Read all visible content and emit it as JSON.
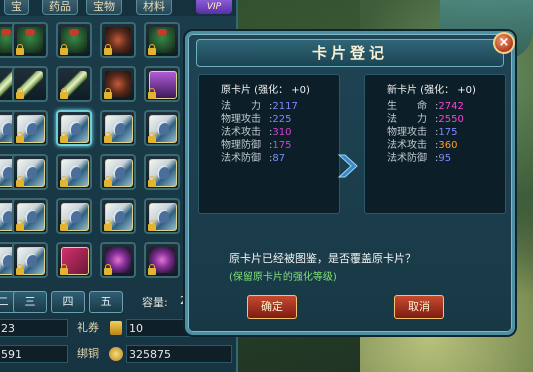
{
  "inventory": {
    "tabs": [
      {
        "label": "宝"
      },
      {
        "label": "药品"
      },
      {
        "label": "宝物"
      },
      {
        "label": "材料"
      }
    ],
    "vip_label": "VIP",
    "pages": [
      "二",
      "三",
      "四",
      "五"
    ],
    "capacity_label": "容量:",
    "capacity_value": "2",
    "gift_label": "礼券",
    "gift_value": "10",
    "bound_label": "绑铜",
    "bound_value": "325875",
    "left_value_1": "23",
    "left_value_2": "591"
  },
  "dialog": {
    "title": "卡片登记",
    "close_label": "×",
    "old_card": {
      "header": "原卡片 (强化： +0)",
      "stats": [
        {
          "name": "法　　力",
          "value": "2117",
          "color": "#7f88ff"
        },
        {
          "name": "物理攻击",
          "value": "225",
          "color": "#7f88ff"
        },
        {
          "name": "法术攻击",
          "value": "310",
          "color": "#d640d6"
        },
        {
          "name": "物理防御",
          "value": "175",
          "color": "#d640d6"
        },
        {
          "name": "法术防御",
          "value": "87",
          "color": "#7f88ff"
        }
      ]
    },
    "new_card": {
      "header": "新卡片 (强化： +0)",
      "stats": [
        {
          "name": "生　　命",
          "value": "2742",
          "color": "#ff40d8"
        },
        {
          "name": "法　　力",
          "value": "2550",
          "color": "#ff40d8"
        },
        {
          "name": "物理攻击",
          "value": "175",
          "color": "#7f88ff"
        },
        {
          "name": "法术攻击",
          "value": "360",
          "color": "#ff9a2e"
        },
        {
          "name": "法术防御",
          "value": "95",
          "color": "#7f88ff"
        }
      ]
    },
    "message": "原卡片已经被图鉴，是否覆盖原卡片？",
    "sub_message": "(保留原卡片的强化等级)",
    "confirm_label": "确定",
    "cancel_label": "取消"
  }
}
